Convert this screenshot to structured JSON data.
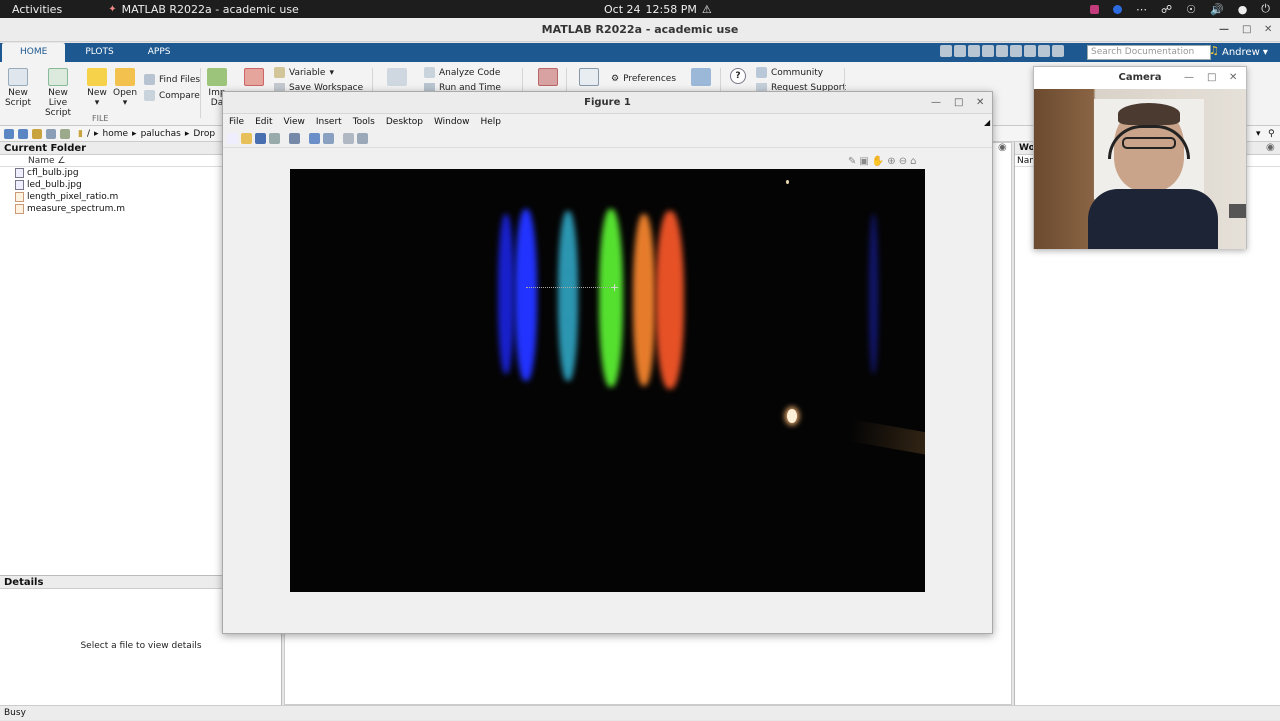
{
  "topbar": {
    "activities": "Activities",
    "app_title": "MATLAB R2022a - academic use",
    "date": "Oct 24",
    "time": "12:58 PM"
  },
  "window": {
    "title": "MATLAB R2022a - academic use"
  },
  "ribbon": {
    "tabs": [
      "HOME",
      "PLOTS",
      "APPS"
    ],
    "search_placeholder": "Search Documentation",
    "user": "Andrew",
    "new_script": [
      "New",
      "Script"
    ],
    "new_live_script": [
      "New",
      "Live Script"
    ],
    "new": "New",
    "open": "Open",
    "find_files": "Find Files",
    "compare": "Compare",
    "file_group": "FILE",
    "import_data": [
      "Imp",
      "Da"
    ],
    "variable": "Variable",
    "save_workspace": "Save Workspace",
    "analyze_code": "Analyze Code",
    "run_and_time": "Run and Time",
    "preferences": "Preferences",
    "community": "Community",
    "request_support": "Request Support"
  },
  "address": {
    "path": [
      "/",
      "home",
      "paluchas",
      "Drop"
    ]
  },
  "current_folder": {
    "title": "Current Folder",
    "column": "Name ∠",
    "files": [
      {
        "name": "cfl_bulb.jpg",
        "type": "image"
      },
      {
        "name": "led_bulb.jpg",
        "type": "image"
      },
      {
        "name": "length_pixel_ratio.m",
        "type": "script"
      },
      {
        "name": "measure_spectrum.m",
        "type": "script"
      }
    ]
  },
  "details": {
    "title": "Details",
    "message": "Select a file to view details"
  },
  "workspace": {
    "title": "Wo",
    "column": "Nam"
  },
  "figure": {
    "title": "Figure 1",
    "menu": [
      "File",
      "Edit",
      "View",
      "Insert",
      "Tools",
      "Desktop",
      "Window",
      "Help"
    ]
  },
  "camera": {
    "title": "Camera"
  },
  "status": {
    "text": "Busy"
  },
  "colors": {
    "ribbon_blue": "#1d5890",
    "spectrum_blue": "#2233ff",
    "spectrum_cyan": "#33b0d0",
    "spectrum_green": "#55e030",
    "spectrum_orange": "#ff8a30",
    "spectrum_red": "#ff5a2a"
  }
}
